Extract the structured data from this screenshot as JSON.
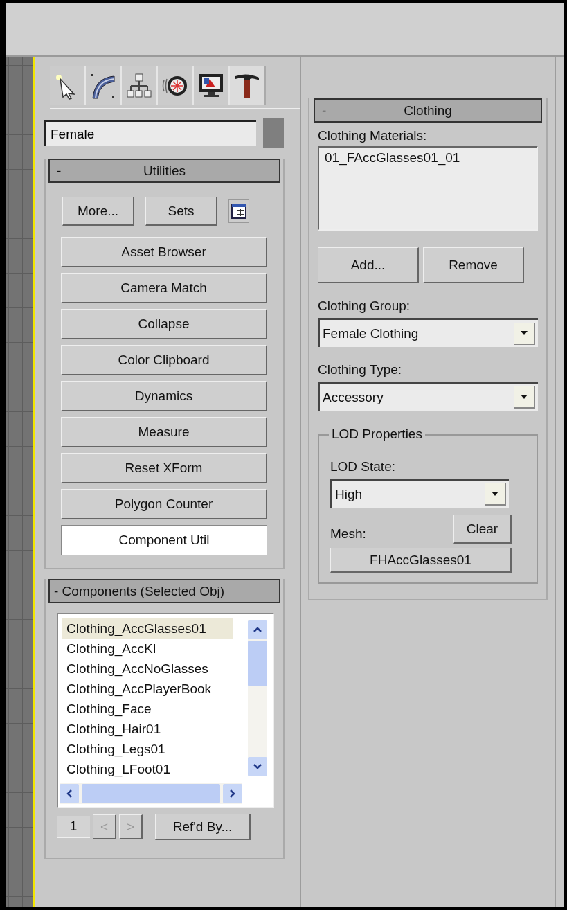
{
  "tabs": [
    {
      "kind": "create",
      "selected": false
    },
    {
      "kind": "modify",
      "selected": false
    },
    {
      "kind": "hierarchy",
      "selected": false
    },
    {
      "kind": "motion",
      "selected": false
    },
    {
      "kind": "display",
      "selected": false
    },
    {
      "kind": "utilities",
      "selected": true
    }
  ],
  "object": {
    "name": "Female",
    "color": "#7f7f7f"
  },
  "utilities": {
    "collapse": "-",
    "title": "Utilities",
    "top_buttons": [
      "More...",
      "Sets"
    ],
    "items": [
      {
        "label": "Asset Browser",
        "selected": false
      },
      {
        "label": "Camera Match",
        "selected": false
      },
      {
        "label": "Collapse",
        "selected": false
      },
      {
        "label": "Color Clipboard",
        "selected": false
      },
      {
        "label": "Dynamics",
        "selected": false
      },
      {
        "label": "Measure",
        "selected": false
      },
      {
        "label": "Reset XForm",
        "selected": false
      },
      {
        "label": "Polygon Counter",
        "selected": false
      },
      {
        "label": "Component Util",
        "selected": true
      }
    ]
  },
  "components": {
    "title": "- Components (Selected Obj)",
    "items": [
      {
        "label": "Clothing_AccGlasses01",
        "selected": true
      },
      {
        "label": "Clothing_AccKI",
        "selected": false
      },
      {
        "label": "Clothing_AccNoGlasses",
        "selected": false
      },
      {
        "label": "Clothing_AccPlayerBook",
        "selected": false
      },
      {
        "label": "Clothing_Face",
        "selected": false
      },
      {
        "label": "Clothing_Hair01",
        "selected": false
      },
      {
        "label": "Clothing_Legs01",
        "selected": false
      },
      {
        "label": "Clothing_LFoot01",
        "selected": false
      }
    ],
    "page": "1",
    "prev": {
      "label": "<",
      "disabled": true
    },
    "next": {
      "label": ">",
      "disabled": true
    },
    "refd_by": "Ref'd By..."
  },
  "clothing": {
    "collapse": "-",
    "title": "Clothing",
    "materials_label": "Clothing Materials:",
    "materials": [
      {
        "label": "01_FAccGlasses01_01",
        "selected": false
      }
    ],
    "buttons": [
      "Add...",
      "Remove"
    ],
    "group_label": "Clothing Group:",
    "group_value": "Female Clothing",
    "type_label": "Clothing Type:",
    "type_value": "Accessory",
    "lod": {
      "title": "LOD Properties",
      "state_label": "LOD State:",
      "state_value": "High",
      "mesh_label": "Mesh:",
      "clear": "Clear",
      "mesh_value": "FHAccGlasses01"
    }
  }
}
